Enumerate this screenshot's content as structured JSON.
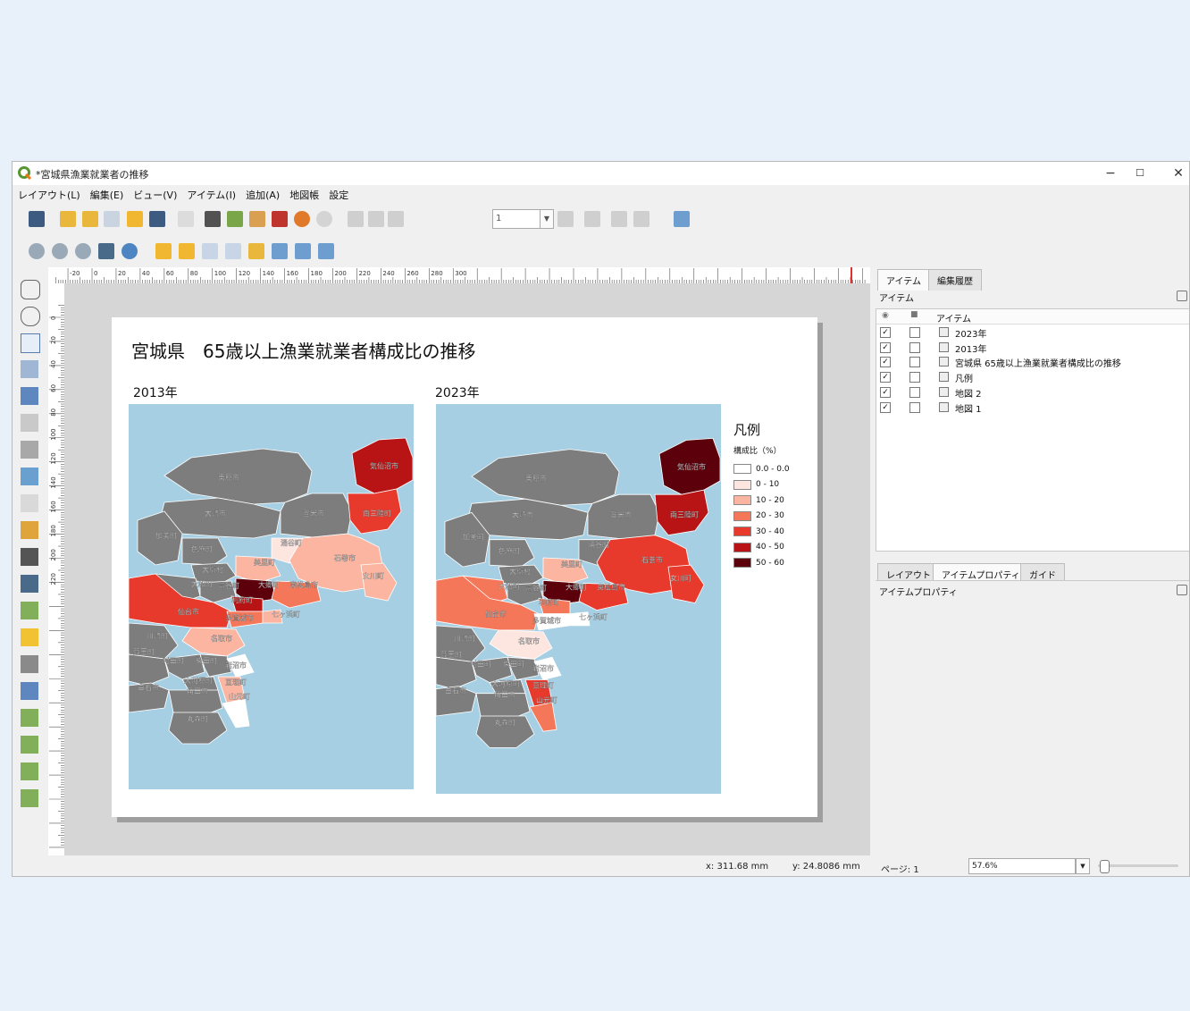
{
  "window": {
    "title": "*宮城県漁業就業者の推移",
    "minimize": "−",
    "maximize": "☐",
    "close": "✕"
  },
  "menu": [
    "レイアウト(L)",
    "編集(E)",
    "ビュー(V)",
    "アイテム(I)",
    "追加(A)",
    "地図帳",
    "設定"
  ],
  "toolbar": {
    "page_value": "1"
  },
  "ruler": {
    "top_ticks": [
      "-20",
      "0",
      "20",
      "40",
      "60",
      "80",
      "100",
      "120",
      "140",
      "160",
      "180",
      "200",
      "220",
      "240",
      "260",
      "280",
      "300"
    ],
    "left_ticks": [
      "0",
      "20",
      "40",
      "60",
      "80",
      "100",
      "120",
      "140",
      "160",
      "180",
      "200",
      "220"
    ]
  },
  "layout": {
    "title": "宮城県　65歳以上漁業就業者構成比の推移",
    "map_left_label": "2013年",
    "map_right_label": "2023年",
    "legend": {
      "title": "凡例",
      "subtitle": "構成比（%）",
      "items": [
        {
          "label": "0.0 - 0.0",
          "color": "#ffffff"
        },
        {
          "label": "0 - 10",
          "color": "#fde5e0"
        },
        {
          "label": "10 - 20",
          "color": "#fbb5a0"
        },
        {
          "label": "20 - 30",
          "color": "#f4775a"
        },
        {
          "label": "30 - 40",
          "color": "#e83a2c"
        },
        {
          "label": "40 - 50",
          "color": "#b81415"
        },
        {
          "label": "50 - 60",
          "color": "#5c000b"
        }
      ]
    },
    "place_labels": [
      "栗原市",
      "大崎市",
      "登米市",
      "気仙沼市",
      "南三陸町",
      "加美町",
      "色麻町",
      "涌谷町",
      "美里町",
      "石巻市",
      "女川町",
      "大衡村",
      "大和町",
      "富谷町",
      "大郷町",
      "東松島市",
      "利府町",
      "仙台市",
      "多賀城市",
      "七ヶ浜町",
      "川崎町",
      "名取市",
      "蔵王町",
      "村田町",
      "柴田町",
      "岩沼市",
      "大河原町",
      "白石市",
      "角田市",
      "亘理町",
      "山元町",
      "丸森町"
    ]
  },
  "right_panel": {
    "tabs_top": [
      "アイテム",
      "編集履歴"
    ],
    "section_title": "アイテム",
    "column_header": "アイテム",
    "items": [
      {
        "name": "2023年",
        "visible": true,
        "locked": false,
        "icon": "text-icon"
      },
      {
        "name": "2013年",
        "visible": true,
        "locked": false,
        "icon": "text-icon"
      },
      {
        "name": "宮城県 65歳以上漁業就業者構成比の推移",
        "visible": true,
        "locked": false,
        "icon": "text-icon"
      },
      {
        "name": "凡例",
        "visible": true,
        "locked": false,
        "icon": "legend-icon"
      },
      {
        "name": "地図 2",
        "visible": true,
        "locked": false,
        "icon": "map-icon"
      },
      {
        "name": "地図 1",
        "visible": true,
        "locked": false,
        "icon": "map-icon"
      }
    ],
    "tabs_bottom": [
      "レイアウト",
      "アイテムプロパティ",
      "ガイド"
    ],
    "props_title": "アイテムプロパティ"
  },
  "status": {
    "x": "x: 311.68 mm",
    "y": "y: 24.8086 mm",
    "page": "ページ: 1",
    "zoom": "57.6%"
  }
}
